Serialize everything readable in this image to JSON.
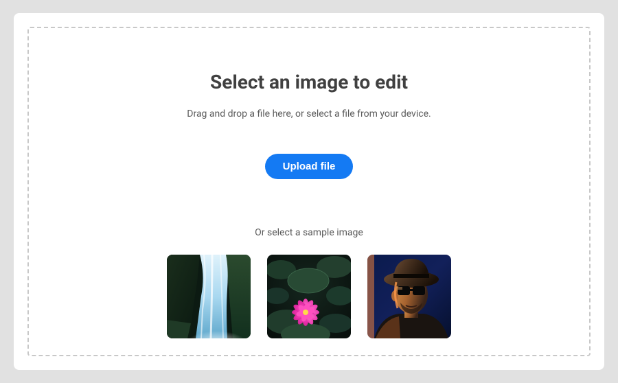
{
  "header": {
    "title": "Select an image to edit",
    "subtitle": "Drag and drop a file here, or select a file from your device."
  },
  "upload": {
    "button_label": "Upload file"
  },
  "samples": {
    "prompt": "Or select a sample image",
    "items": [
      {
        "name": "waterfall"
      },
      {
        "name": "lotus-flower"
      },
      {
        "name": "man-with-hat"
      }
    ]
  }
}
